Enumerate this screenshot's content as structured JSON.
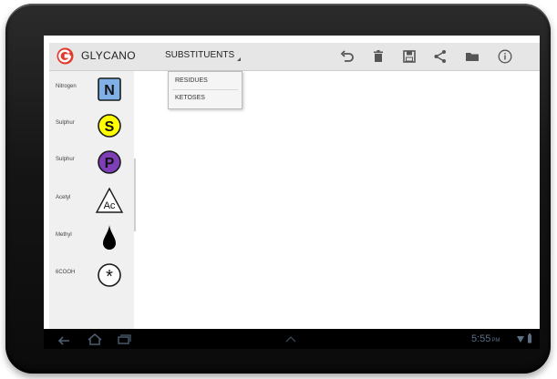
{
  "app": {
    "title": "GLYCANO"
  },
  "toolbar": {
    "menu_label": "SUBSTITUENTS",
    "icons": [
      "undo-icon",
      "trash-icon",
      "save-icon",
      "share-icon",
      "folder-icon",
      "info-icon"
    ]
  },
  "dropdown": {
    "items": [
      {
        "label": "RESIDUES"
      },
      {
        "label": "KETOSES"
      }
    ]
  },
  "sidebar": {
    "items": [
      {
        "label": "Nitrogen",
        "symbol": "N",
        "color": "#7fb0e8"
      },
      {
        "label": "Sulphur",
        "symbol": "S",
        "color": "#ffff00"
      },
      {
        "label": "Sulphur",
        "symbol": "P",
        "color": "#7d3eb8"
      },
      {
        "label": "Acetyl",
        "symbol": "Ac",
        "color": "#ffffff"
      },
      {
        "label": "Methyl",
        "symbol": "",
        "color": "#000000"
      },
      {
        "label": "6COOH",
        "symbol": "*",
        "color": "#ffffff"
      }
    ]
  },
  "statusbar": {
    "time": "5:55",
    "ampm": "PM"
  },
  "colors": {
    "logo_red": "#e03b2d",
    "bezel": "#151515"
  }
}
